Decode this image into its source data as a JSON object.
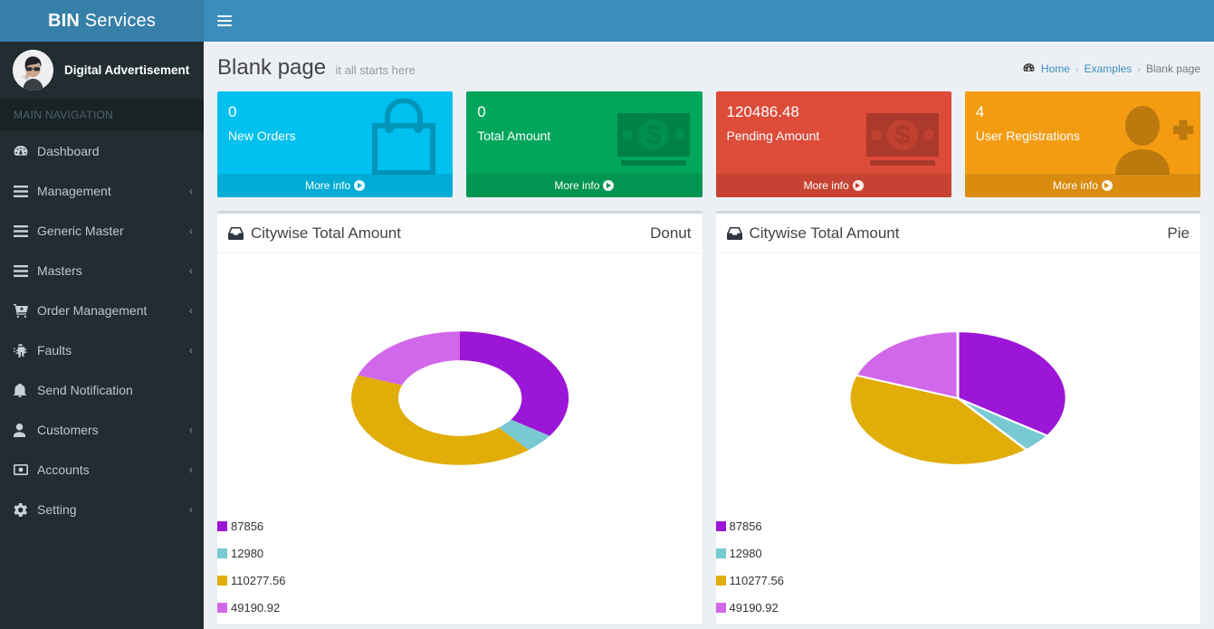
{
  "brand": {
    "bold": "BIN",
    "light": "Services"
  },
  "navbar": {
    "toggle_icon": "hamburger-icon"
  },
  "sidebar": {
    "user": {
      "name": "Digital Advertisement",
      "avatar_icon": "user-avatar"
    },
    "section_header": "MAIN NAVIGATION",
    "items": [
      {
        "label": "Dashboard",
        "icon": "dashboard-icon",
        "caret": false
      },
      {
        "label": "Management",
        "icon": "bars-icon",
        "caret": true
      },
      {
        "label": "Generic Master",
        "icon": "bars-icon",
        "caret": true
      },
      {
        "label": "Masters",
        "icon": "bars-icon",
        "caret": true
      },
      {
        "label": "Order Management",
        "icon": "cart-icon",
        "caret": true
      },
      {
        "label": "Faults",
        "icon": "bug-icon",
        "caret": true
      },
      {
        "label": "Send Notification",
        "icon": "bell-icon",
        "caret": false
      },
      {
        "label": "Customers",
        "icon": "user-icon",
        "caret": true
      },
      {
        "label": "Accounts",
        "icon": "money-icon",
        "caret": true
      },
      {
        "label": "Setting",
        "icon": "gear-icon",
        "caret": true
      }
    ],
    "caret_glyph": "‹"
  },
  "header": {
    "title": "Blank page",
    "subtitle": "it all starts here",
    "breadcrumb": {
      "home_icon": "dashboard-icon",
      "home": "Home",
      "sep": "›",
      "examples": "Examples",
      "current": "Blank page"
    }
  },
  "info_boxes": [
    {
      "value": "0",
      "label": "New Orders",
      "footer": "More info",
      "color": "#00c0ef",
      "footer_color": "#00acd6",
      "icon": "shopping-bag-icon"
    },
    {
      "value": "0",
      "label": "Total Amount",
      "footer": "More info",
      "color": "#00a65a",
      "footer_color": "#008d4c",
      "icon": "money-icon"
    },
    {
      "value": "120486.48",
      "label": "Pending Amount",
      "footer": "More info",
      "color": "#dd4b39",
      "footer_color": "#d33724",
      "icon": "money-icon"
    },
    {
      "value": "4",
      "label": "User Registrations",
      "footer": "More info",
      "color": "#f39c12",
      "footer_color": "#db8b0b",
      "icon": "user-plus-icon"
    }
  ],
  "panels": [
    {
      "title": "Citywise Total Amount",
      "tool": "Donut",
      "icon": "inbox-icon"
    },
    {
      "title": "Citywise Total Amount",
      "tool": "Pie",
      "icon": "inbox-icon"
    }
  ],
  "chart_data": [
    {
      "type": "pie",
      "variant": "donut",
      "title": "Citywise Total Amount",
      "labels": [
        "87856",
        "12980",
        "110277.56",
        "49190.92"
      ],
      "values": [
        87856,
        12980,
        110277.56,
        49190.92
      ],
      "colors": [
        "#9b16d6",
        "#79c9d3",
        "#e0ad09",
        "#d168ea"
      ],
      "legend_position": "bottom-left",
      "grid": false
    },
    {
      "type": "pie",
      "variant": "pie-3d",
      "title": "Citywise Total Amount",
      "labels": [
        "87856",
        "12980",
        "110277.56",
        "49190.92"
      ],
      "values": [
        87856,
        12980,
        110277.56,
        49190.92
      ],
      "colors": [
        "#9b16d6",
        "#79c9d3",
        "#e0ad09",
        "#d168ea"
      ],
      "legend_position": "bottom-left",
      "grid": false
    }
  ]
}
